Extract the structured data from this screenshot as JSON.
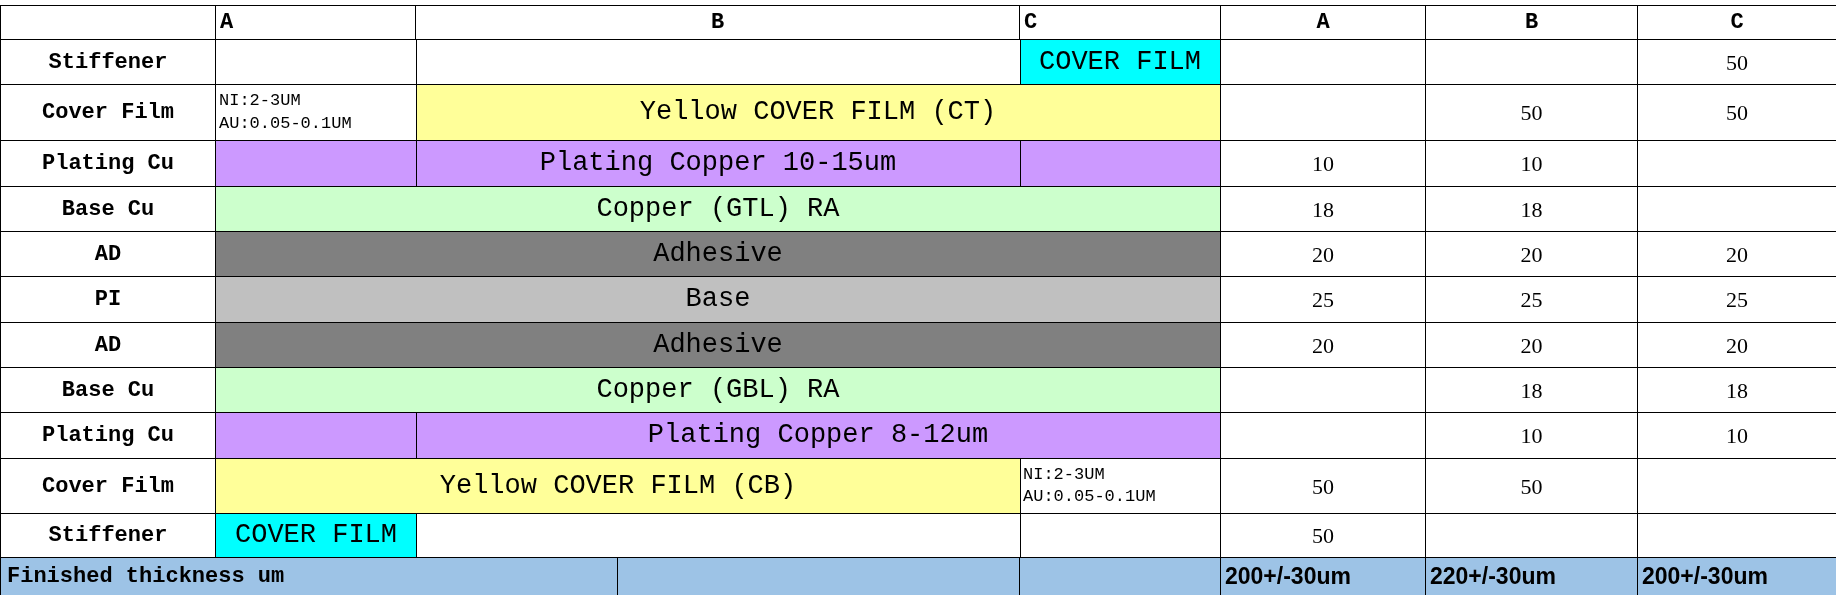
{
  "columns": [
    {
      "label": "A"
    },
    {
      "label": "B"
    },
    {
      "label": "C"
    }
  ],
  "value_columns": [
    {
      "label": "A"
    },
    {
      "label": "B"
    },
    {
      "label": "C"
    }
  ],
  "layers": [
    {
      "name": "Stiffener",
      "cells": [
        {},
        {
          "merged": false
        },
        {
          "merged": false,
          "kind": "fill",
          "text": "COVER FILM",
          "color": "#00ffff"
        }
      ],
      "values": {
        "c": "50"
      }
    },
    {
      "name": "Cover Film",
      "cells": [
        {
          "kind": "note",
          "lines": [
            "NI:2-3UM",
            "AU:0.05-0.1UM"
          ]
        },
        {
          "merged": false,
          "kind": "fill",
          "text": "Yellow COVER FILM (CT)",
          "color": "#ffff99"
        },
        {
          "merged": true
        }
      ],
      "values": {
        "b": "50",
        "c": "50"
      }
    },
    {
      "name": "Plating Cu",
      "cells": [
        {
          "kind": "fill",
          "color": "#cc99ff"
        },
        {
          "merged": false,
          "kind": "fill",
          "text": "Plating Copper 10-15um",
          "color": "#cc99ff"
        },
        {
          "merged": false,
          "kind": "fill",
          "color": "#cc99ff"
        }
      ],
      "values": {
        "a": "10",
        "b": "10"
      }
    },
    {
      "name": "Base Cu",
      "cells": [
        {
          "kind": "fill",
          "text": "Copper (GTL) RA",
          "color": "#ccffcc"
        },
        {
          "merged": true
        },
        {
          "merged": true
        }
      ],
      "values": {
        "a": "18",
        "b": "18"
      }
    },
    {
      "name": "AD",
      "cells": [
        {
          "kind": "fill",
          "text": "Adhesive",
          "color": "#808080"
        },
        {
          "merged": true
        },
        {
          "merged": true
        }
      ],
      "values": {
        "a": "20",
        "b": "20",
        "c": "20"
      }
    },
    {
      "name": "PI",
      "cells": [
        {
          "kind": "fill",
          "text": "Base",
          "color": "#c0c0c0"
        },
        {
          "merged": true
        },
        {
          "merged": true
        }
      ],
      "values": {
        "a": "25",
        "b": "25",
        "c": "25"
      }
    },
    {
      "name": "AD",
      "cells": [
        {
          "kind": "fill",
          "text": "Adhesive",
          "color": "#808080"
        },
        {
          "merged": true
        },
        {
          "merged": true
        }
      ],
      "values": {
        "a": "20",
        "b": "20",
        "c": "20"
      }
    },
    {
      "name": "Base Cu",
      "cells": [
        {
          "kind": "fill",
          "text": "Copper (GBL) RA",
          "color": "#ccffcc"
        },
        {
          "merged": true
        },
        {
          "merged": true
        }
      ],
      "values": {
        "b": "18",
        "c": "18"
      }
    },
    {
      "name": "Plating Cu",
      "cells": [
        {
          "kind": "fill",
          "color": "#cc99ff"
        },
        {
          "merged": false,
          "kind": "fill",
          "text": "Plating Copper 8-12um",
          "color": "#cc99ff"
        },
        {
          "merged": true
        }
      ],
      "values": {
        "b": "10",
        "c": "10"
      }
    },
    {
      "name": "Cover Film",
      "cells": [
        {
          "kind": "fill",
          "text": "Yellow COVER FILM (CB)",
          "color": "#ffff99"
        },
        {
          "merged": true
        },
        {
          "merged": false,
          "kind": "note",
          "lines": [
            "NI:2-3UM",
            "AU:0.05-0.1UM"
          ]
        }
      ],
      "values": {
        "a": "50",
        "b": "50"
      }
    },
    {
      "name": "Stiffener",
      "cells": [
        {
          "kind": "fill",
          "text": "COVER FILM",
          "color": "#00ffff"
        },
        {
          "merged": false
        },
        {
          "merged": false
        }
      ],
      "values": {
        "a": "50"
      }
    }
  ],
  "footer": {
    "label": "Finished thickness um",
    "totals": [
      "200+/-30um",
      "220+/-30um",
      "200+/-30um"
    ]
  }
}
